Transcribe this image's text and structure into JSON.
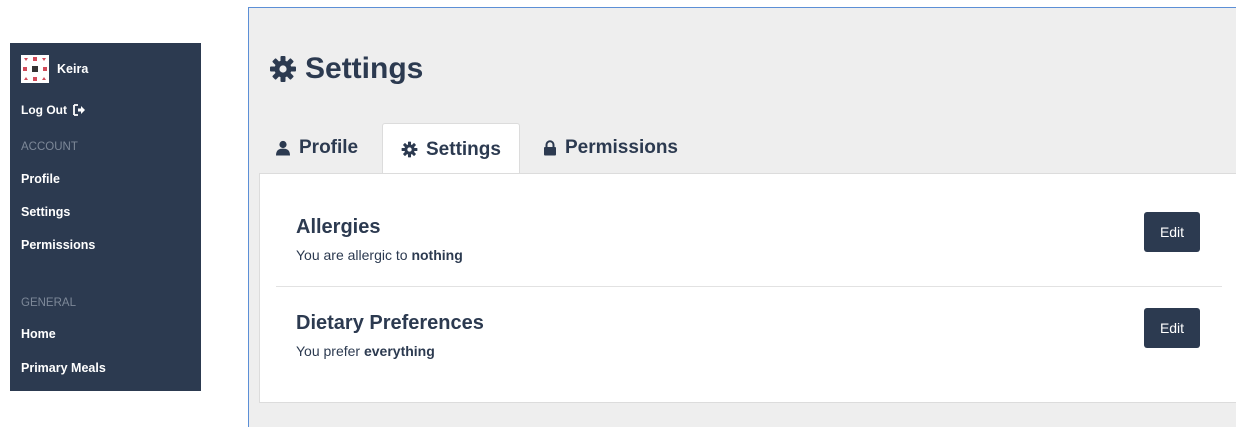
{
  "sidebar": {
    "user_name": "Keira",
    "logout_label": "Log Out",
    "account_section": "ACCOUNT",
    "account_items": [
      "Profile",
      "Settings",
      "Permissions"
    ],
    "general_section": "GENERAL",
    "general_items": [
      "Home",
      "Primary Meals"
    ]
  },
  "page": {
    "title": "Settings"
  },
  "tabs": [
    {
      "label": "Profile",
      "icon": "user-icon"
    },
    {
      "label": "Settings",
      "icon": "gear-icon",
      "active": true
    },
    {
      "label": "Permissions",
      "icon": "lock-icon"
    }
  ],
  "preferences": {
    "allergies": {
      "title": "Allergies",
      "text_prefix": "You are allergic to",
      "value": "nothing",
      "edit_label": "Edit"
    },
    "dietary": {
      "title": "Dietary Preferences",
      "text_prefix": "You prefer",
      "value": "everything",
      "edit_label": "Edit"
    }
  },
  "colors": {
    "sidebar_bg": "#2c3a50",
    "accent": "#2c3a50",
    "panel_bg": "#eeeeee"
  }
}
